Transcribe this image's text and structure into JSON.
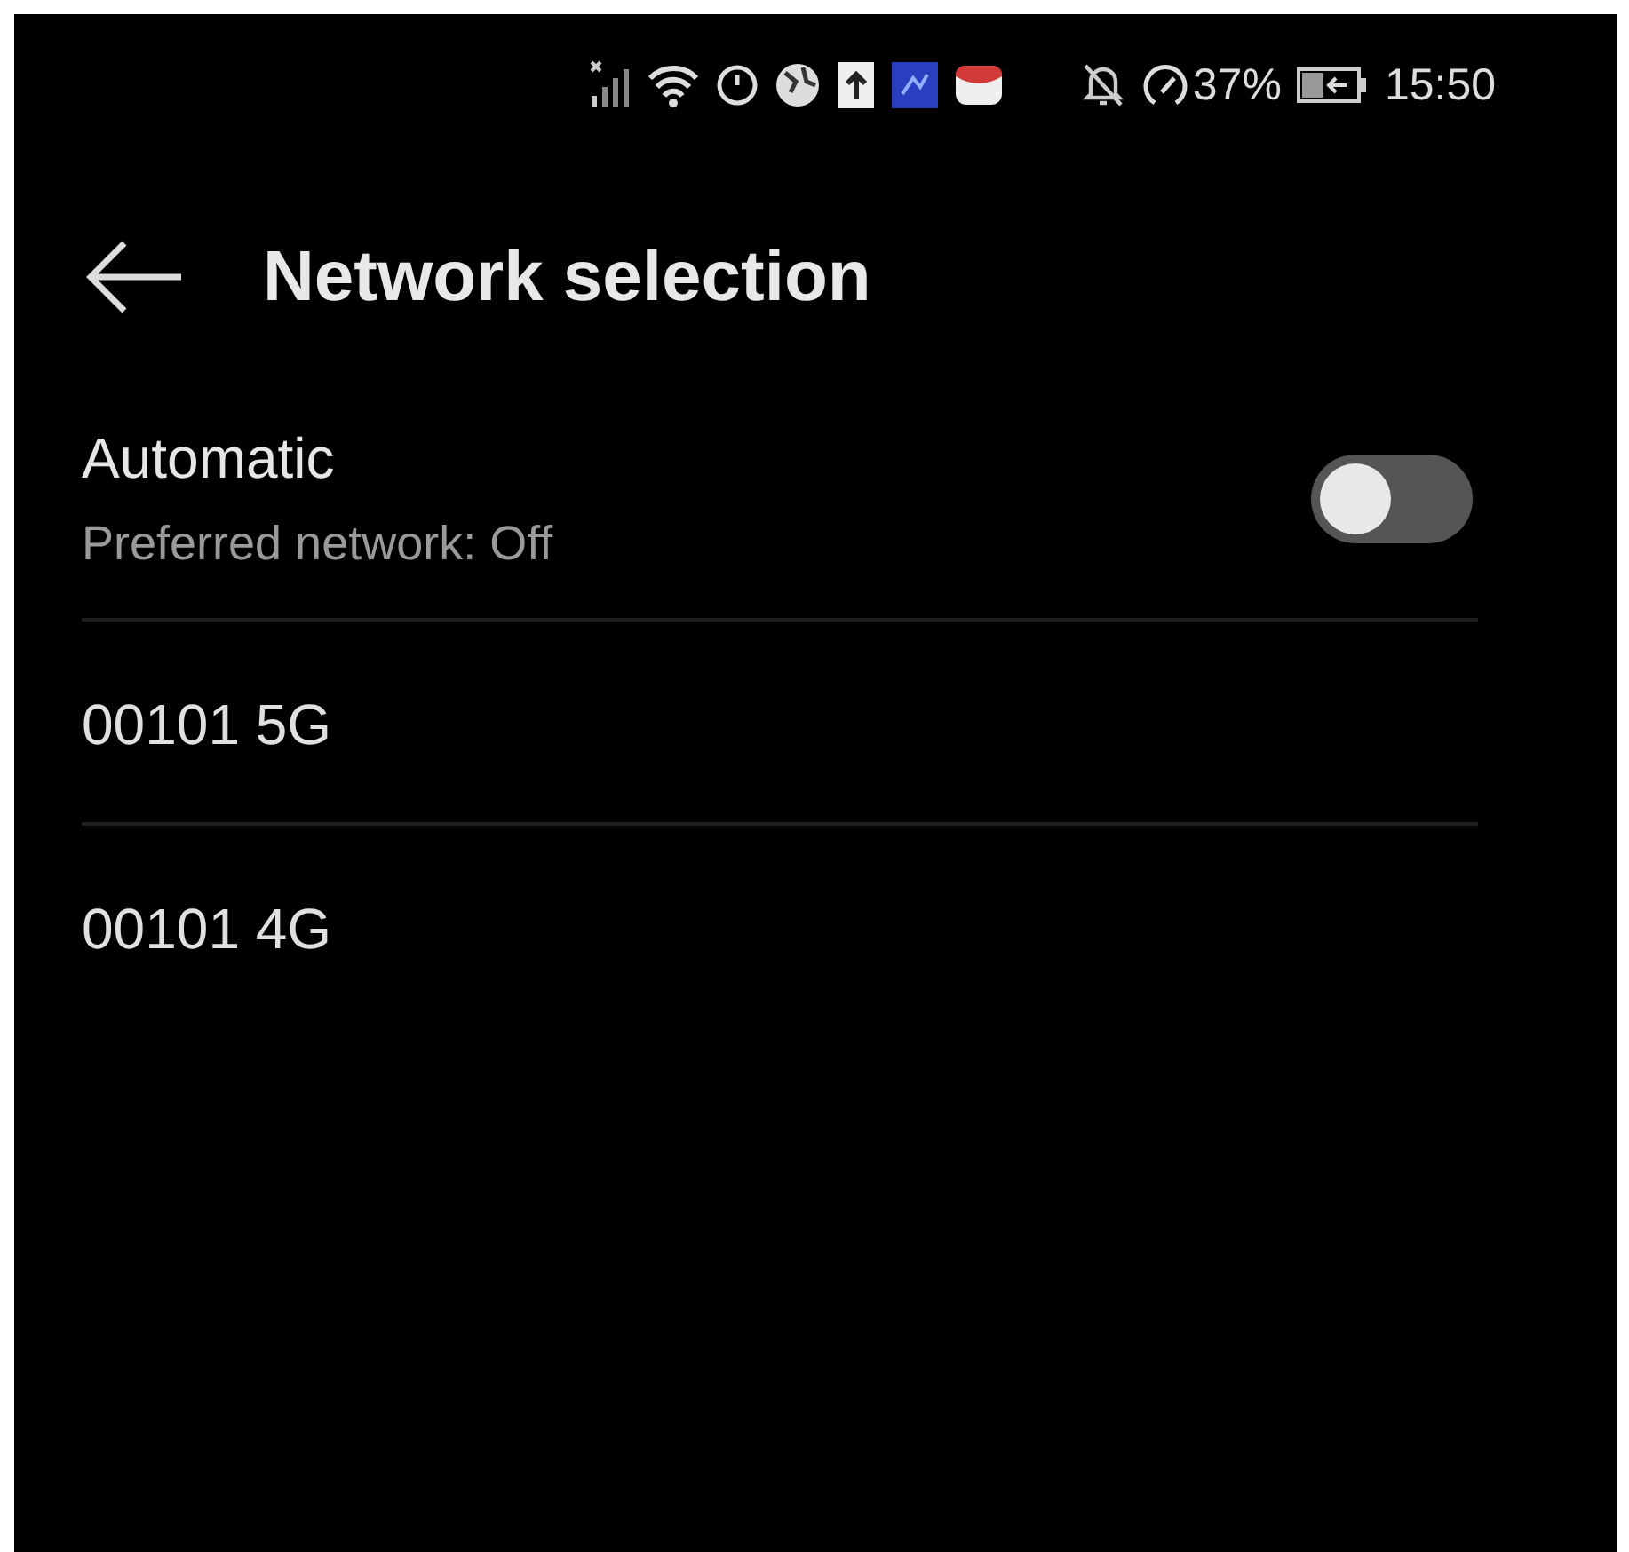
{
  "status_bar": {
    "battery_percent": "37%",
    "time": "15:50"
  },
  "header": {
    "title": "Network selection"
  },
  "automatic": {
    "label": "Automatic",
    "subtitle": "Preferred network: Off",
    "on": false
  },
  "networks": [
    {
      "name": "00101 5G"
    },
    {
      "name": "00101 4G"
    }
  ]
}
